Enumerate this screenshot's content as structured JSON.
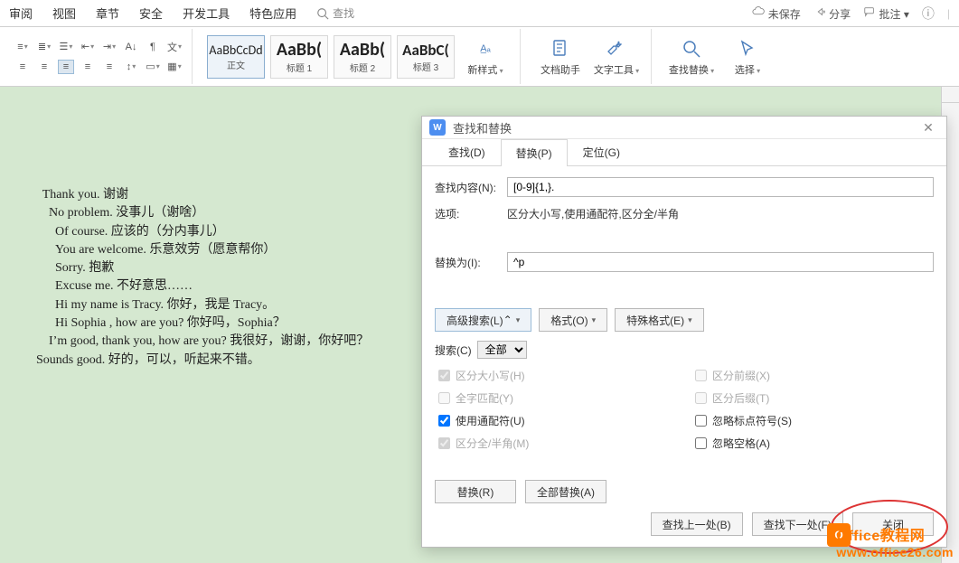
{
  "menubar": {
    "items": [
      "审阅",
      "视图",
      "章节",
      "安全",
      "开发工具",
      "特色应用"
    ],
    "search_placeholder": "查找",
    "right": {
      "unsaved": "未保存",
      "share": "分享",
      "annotate": "批注"
    }
  },
  "ribbon": {
    "styles": [
      {
        "sample": "AaBbCcDd",
        "name": "正文"
      },
      {
        "sample": "AaBb(",
        "name": "标题 1"
      },
      {
        "sample": "AaBb(",
        "name": "标题 2"
      },
      {
        "sample": "AaBbC(",
        "name": "标题 3"
      }
    ],
    "new_style": "新样式",
    "doc_helper": "文档助手",
    "text_tools": "文字工具",
    "find_replace": "查找替换",
    "select": "选择"
  },
  "document": {
    "lines": [
      "  Thank you. 谢谢",
      "    No problem. 没事儿（谢啥）",
      "      Of course. 应该的（分内事儿）",
      "      You are welcome. 乐意效劳（愿意帮你）",
      "      Sorry. 抱歉",
      "      Excuse me. 不好意思……",
      "      Hi my name is Tracy. 你好，我是 Tracy。",
      "      Hi Sophia , how are you? 你好吗，Sophia？",
      "    I’m good, thank you, how are you? 我很好，谢谢，你好吧？",
      "Sounds good. 好的，可以，听起来不错。"
    ]
  },
  "dialog": {
    "title": "查找和替换",
    "tabs": {
      "find": "查找(D)",
      "replace": "替换(P)",
      "goto": "定位(G)"
    },
    "find_label": "查找内容(N):",
    "find_value": "[0-9]{1,}.",
    "options_label": "选项:",
    "options_value": "区分大小写,使用通配符,区分全/半角",
    "replace_label": "替换为(I):",
    "replace_value": "^p",
    "adv_search": "高级搜索(L)",
    "format": "格式(O)",
    "special": "特殊格式(E)",
    "search_label": "搜索(C)",
    "search_scope": "全部",
    "chk": {
      "case": "区分大小写(H)",
      "prefix": "区分前缀(X)",
      "whole": "全字匹配(Y)",
      "suffix": "区分后缀(T)",
      "wildcard": "使用通配符(U)",
      "punct": "忽略标点符号(S)",
      "width": "区分全/半角(M)",
      "space": "忽略空格(A)"
    },
    "replace_btn": "替换(R)",
    "replace_all_btn": "全部替换(A)",
    "find_prev": "查找上一处(B)",
    "find_next": "查找下一处(F)",
    "close": "关闭"
  },
  "watermark": {
    "line1": "Office教程网",
    "line2": "www.office26.com"
  }
}
